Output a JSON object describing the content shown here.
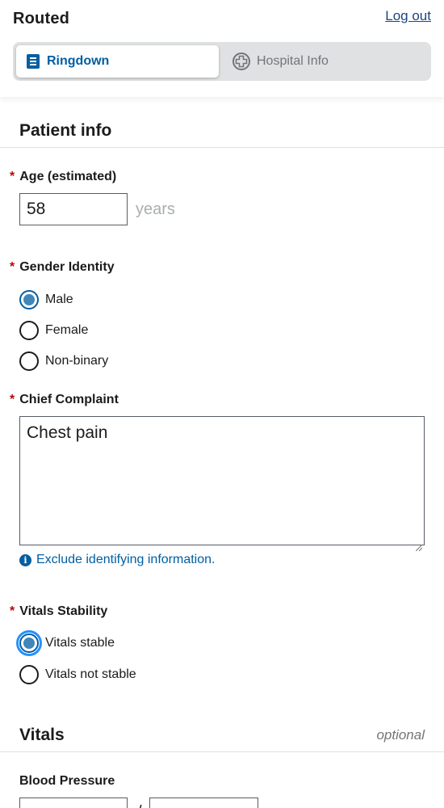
{
  "app": {
    "logo_text": "Routed",
    "logout_label": "Log out"
  },
  "tabs": [
    {
      "label": "Ringdown",
      "icon": "ringdown-icon",
      "active": true
    },
    {
      "label": "Hospital Info",
      "icon": "hospital-icon",
      "active": false
    }
  ],
  "patient_info": {
    "title": "Patient info",
    "age": {
      "label": "Age (estimated)",
      "value": "58",
      "suffix": "years"
    },
    "gender": {
      "label": "Gender Identity",
      "options": [
        "Male",
        "Female",
        "Non-binary"
      ],
      "selected": "Male"
    },
    "chief_complaint": {
      "label": "Chief Complaint",
      "value": "Chest pain",
      "hint": "Exclude identifying information."
    },
    "vitals_stability": {
      "label": "Vitals Stability",
      "options": [
        "Vitals stable",
        "Vitals not stable"
      ],
      "selected": "Vitals stable"
    }
  },
  "vitals": {
    "title": "Vitals",
    "optional_label": "optional",
    "blood_pressure": {
      "label": "Blood Pressure",
      "separator": "/",
      "systolic": "",
      "diastolic": ""
    }
  },
  "colors": {
    "accent": "#005ea2",
    "required": "#b50909",
    "focus": "#2491ff"
  }
}
